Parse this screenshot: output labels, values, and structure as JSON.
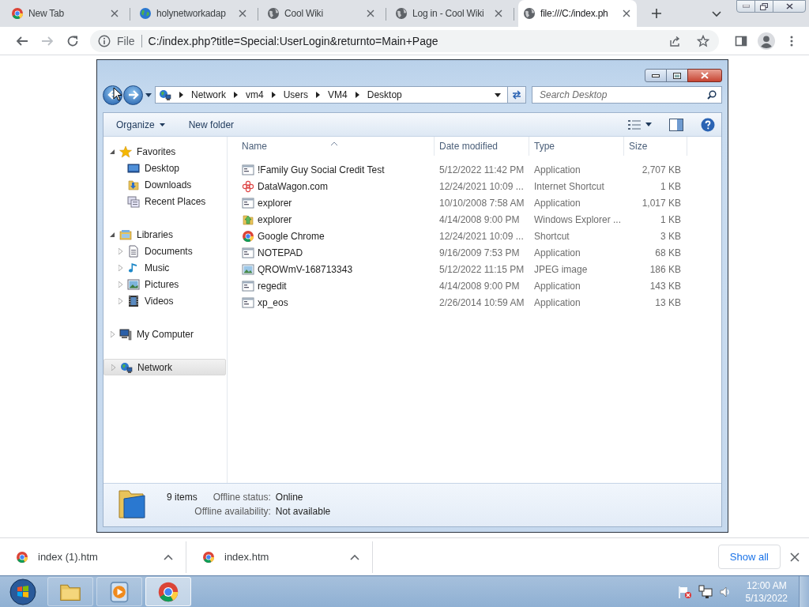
{
  "browser": {
    "tabs": [
      {
        "title": "New Tab",
        "kind": "chrome",
        "selected": false
      },
      {
        "title": "holynetworkadap",
        "kind": "earth",
        "selected": false
      },
      {
        "title": "Cool Wiki",
        "kind": "globe",
        "selected": false
      },
      {
        "title": "Log in - Cool Wiki",
        "kind": "globe",
        "selected": false
      },
      {
        "title": "file:///C:/index.ph",
        "kind": "globe",
        "selected": true
      }
    ],
    "nav_buttons": [
      {
        "kind": "back",
        "disabled": false
      },
      {
        "kind": "forward",
        "disabled": true
      },
      {
        "kind": "reload",
        "disabled": false
      }
    ],
    "omnibox": {
      "scheme": "File",
      "url": "C:/index.php?title=Special:UserLogin&returnto=Main+Page"
    }
  },
  "explorer": {
    "breadcrumb": [
      "Network",
      "vm4",
      "Users",
      "VM4",
      "Desktop"
    ],
    "search": {
      "placeholder": "Search Desktop"
    },
    "commands": [
      {
        "label": "Organize",
        "has_menu": true
      },
      {
        "label": "New folder",
        "has_menu": false
      }
    ],
    "nav_tree": [
      {
        "label": "Favorites",
        "kind": "star",
        "expanded": true,
        "selected": false,
        "children": [
          {
            "label": "Desktop",
            "kind": "desktop",
            "selected": false
          },
          {
            "label": "Downloads",
            "kind": "downloads",
            "selected": false
          },
          {
            "label": "Recent Places",
            "kind": "recent",
            "selected": false
          }
        ]
      },
      {
        "label": "Libraries",
        "kind": "library",
        "expanded": true,
        "selected": false,
        "children": [
          {
            "label": "Documents",
            "kind": "document",
            "expanded": false,
            "selected": false
          },
          {
            "label": "Music",
            "kind": "music",
            "expanded": false,
            "selected": false
          },
          {
            "label": "Pictures",
            "kind": "pictures",
            "expanded": false,
            "selected": false
          },
          {
            "label": "Videos",
            "kind": "videos",
            "expanded": false,
            "selected": false
          }
        ]
      },
      {
        "label": "My Computer",
        "kind": "computer",
        "expanded": false,
        "selected": false
      },
      {
        "label": "Network",
        "kind": "network",
        "expanded": false,
        "selected": true
      }
    ],
    "columns": [
      {
        "label": "Name",
        "sorted": true
      },
      {
        "label": "Date modified",
        "sorted": false
      },
      {
        "label": "Type",
        "sorted": false
      },
      {
        "label": "Size",
        "sorted": false
      }
    ],
    "files": [
      {
        "name": "!Family Guy Social Credit Test",
        "kind": "app",
        "date": "5/12/2022 11:42 PM",
        "type": "Application",
        "size": "2,707 KB"
      },
      {
        "name": "DataWagon.com",
        "kind": "web",
        "date": "12/24/2021 10:09 ...",
        "type": "Internet Shortcut",
        "size": "1 KB"
      },
      {
        "name": "explorer",
        "kind": "app",
        "date": "10/10/2008 7:58 AM",
        "type": "Application",
        "size": "1,017 KB"
      },
      {
        "name": "explorer",
        "kind": "explorer",
        "date": "4/14/2008 9:00 PM",
        "type": "Windows Explorer ...",
        "size": "1 KB"
      },
      {
        "name": "Google Chrome",
        "kind": "chrome",
        "date": "12/24/2021 10:09 ...",
        "type": "Shortcut",
        "size": "3 KB"
      },
      {
        "name": "NOTEPAD",
        "kind": "app",
        "date": "9/16/2009 7:53 PM",
        "type": "Application",
        "size": "68 KB"
      },
      {
        "name": "QROWmV-168713343",
        "kind": "image",
        "date": "5/12/2022 11:15 PM",
        "type": "JPEG image",
        "size": "186 KB"
      },
      {
        "name": "regedit",
        "kind": "app",
        "date": "4/14/2008 9:00 PM",
        "type": "Application",
        "size": "143 KB"
      },
      {
        "name": "xp_eos",
        "kind": "app",
        "date": "2/26/2014 10:59 AM",
        "type": "Application",
        "size": "13 KB"
      }
    ],
    "details": {
      "count": "9 items",
      "fields": [
        {
          "label": "Offline status:",
          "value": "Online"
        },
        {
          "label": "Offline availability:",
          "value": "Not available"
        }
      ]
    }
  },
  "downloads": {
    "items": [
      {
        "filename": "index (1).htm"
      },
      {
        "filename": "index.htm"
      }
    ],
    "show_all": "Show all"
  },
  "taskbar": {
    "buttons": [
      {
        "kind": "folder",
        "selected": false
      },
      {
        "kind": "media",
        "selected": false
      },
      {
        "kind": "chrome",
        "selected": true
      }
    ],
    "clock": {
      "time": "12:00 AM",
      "date": "5/13/2022"
    }
  }
}
